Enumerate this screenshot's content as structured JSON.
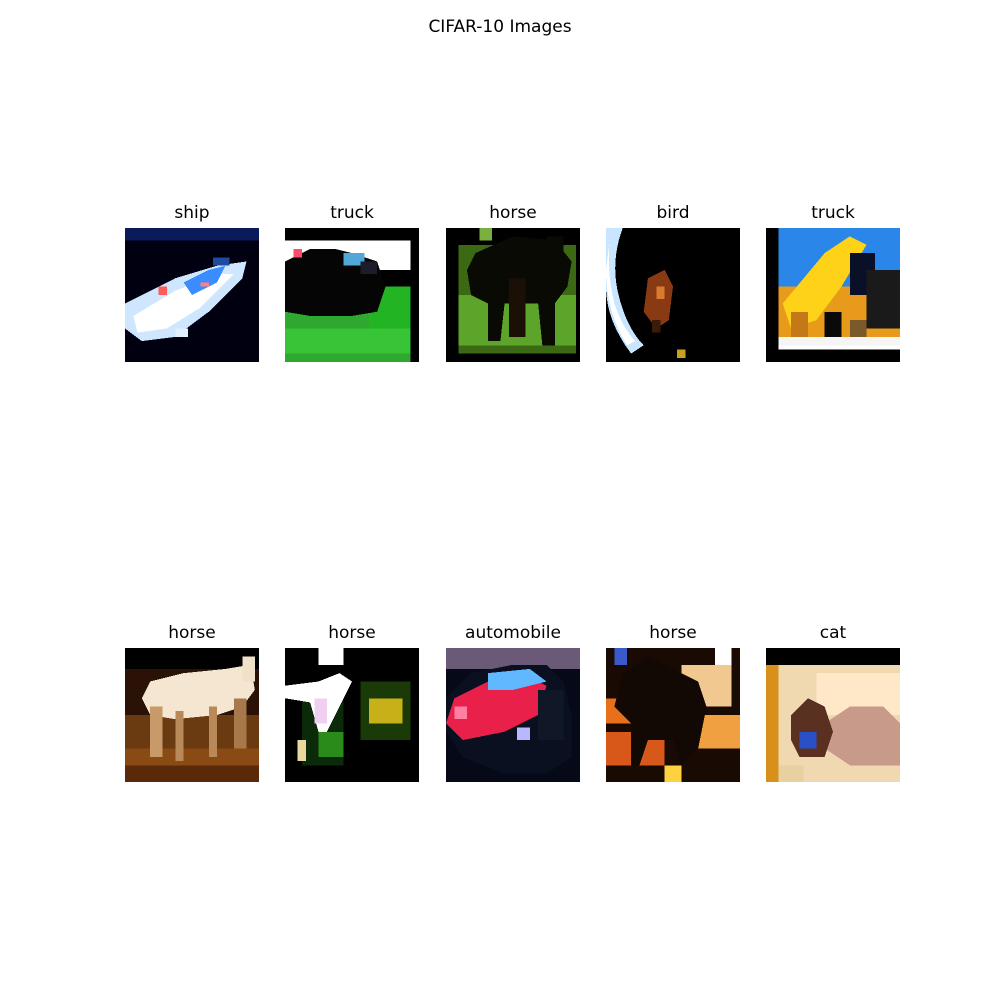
{
  "figure": {
    "title": "CIFAR-10 Images"
  },
  "images": [
    {
      "label": "ship"
    },
    {
      "label": "truck"
    },
    {
      "label": "horse"
    },
    {
      "label": "bird"
    },
    {
      "label": "truck"
    },
    {
      "label": "horse"
    },
    {
      "label": "horse"
    },
    {
      "label": "automobile"
    },
    {
      "label": "horse"
    },
    {
      "label": "cat"
    }
  ]
}
